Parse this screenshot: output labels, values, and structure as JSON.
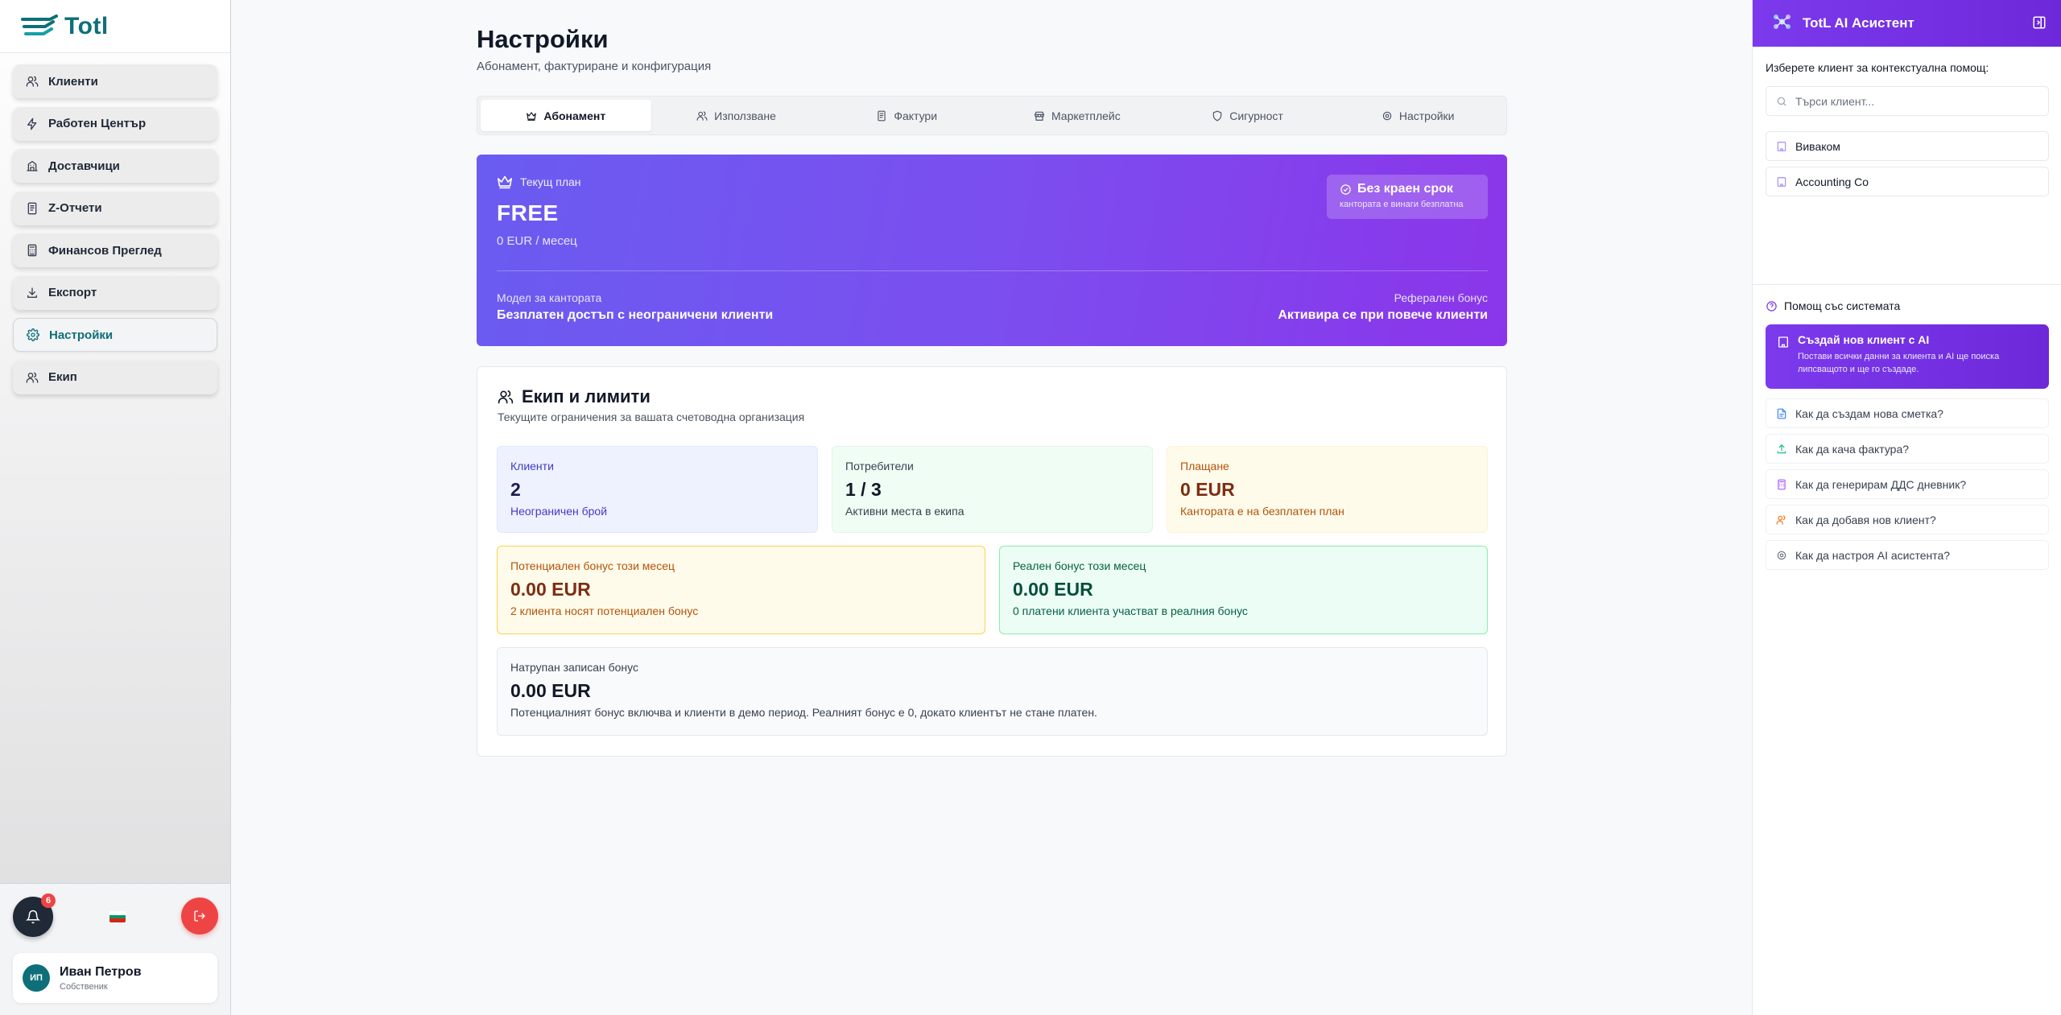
{
  "brand": {
    "name": "Totl"
  },
  "sidebar": {
    "items": [
      {
        "label": "Клиенти",
        "icon": "users-icon",
        "active": false
      },
      {
        "label": "Работен Център",
        "icon": "bolt-icon",
        "active": false
      },
      {
        "label": "Доставчици",
        "icon": "building-icon",
        "active": false
      },
      {
        "label": "Z-Отчети",
        "icon": "receipt-icon",
        "active": false
      },
      {
        "label": "Финансов Преглед",
        "icon": "calculator-icon",
        "active": false
      },
      {
        "label": "Експорт",
        "icon": "download-icon",
        "active": false
      },
      {
        "label": "Настройки",
        "icon": "gear-icon",
        "active": true
      },
      {
        "label": "Екип",
        "icon": "team-icon",
        "active": false
      }
    ],
    "notifications_count": "6",
    "user": {
      "initials": "ИП",
      "name": "Иван Петров",
      "role": "Собственик"
    }
  },
  "page": {
    "title": "Настройки",
    "subtitle": "Абонамент, фактуриране и конфигурация"
  },
  "tabs": [
    {
      "label": "Абонамент",
      "icon": "crown-icon",
      "active": true
    },
    {
      "label": "Използване",
      "icon": "users-icon",
      "active": false
    },
    {
      "label": "Фактури",
      "icon": "document-icon",
      "active": false
    },
    {
      "label": "Маркетплейс",
      "icon": "store-icon",
      "active": false
    },
    {
      "label": "Сигурност",
      "icon": "shield-icon",
      "active": false
    },
    {
      "label": "Настройки",
      "icon": "gear-icon",
      "active": false
    }
  ],
  "plan": {
    "label": "Текущ план",
    "name": "FREE",
    "price": "0 EUR / месец",
    "badge_title": "Без краен срок",
    "badge_sub": "кантората е винаги безплатна",
    "model_label": "Модел за кантората",
    "model_value": "Безплатен достъп с неограничени клиенти",
    "referral_label": "Реферален бонус",
    "referral_value": "Активира се при повече клиенти"
  },
  "team": {
    "title": "Екип и лимити",
    "subtitle": "Текущите ограничения за вашата счетоводна организация",
    "stats": [
      {
        "label": "Клиенти",
        "value": "2",
        "note": "Неограничен брой"
      },
      {
        "label": "Потребители",
        "value": "1 / 3",
        "note": "Активни места в екипа"
      },
      {
        "label": "Плащане",
        "value": "0 EUR",
        "note": "Кантората е на безплатен план"
      }
    ],
    "bonuses": [
      {
        "label": "Потенциален бонус този месец",
        "value": "0.00 EUR",
        "note": "2 клиента носят потенциален бонус"
      },
      {
        "label": "Реален бонус този месец",
        "value": "0.00 EUR",
        "note": "0 платени клиента участват в реалния бонус"
      }
    ],
    "accumulated": {
      "label": "Натрупан записан бонус",
      "value": "0.00 EUR",
      "note": "Потенциалният бонус включва и клиенти в демо период. Реалният бонус е 0, докато клиентът не стане платен."
    }
  },
  "ai": {
    "title": "TotL AI Асистент",
    "prompt": "Изберете клиент за контекстуална помощ:",
    "search_placeholder": "Търси клиент...",
    "clients": [
      "Виваком",
      "Accounting Co"
    ],
    "help_title": "Помощ със системата",
    "create": {
      "title": "Създай нов клиент с AI",
      "desc": "Постави всички данни за клиента и AI ще поиска липсващото и ще го създаде."
    },
    "help_items": [
      {
        "label": "Как да създам нова сметка?",
        "icon": "document-icon",
        "color": "#3b82f6"
      },
      {
        "label": "Как да кача фактура?",
        "icon": "upload-icon",
        "color": "#10b981"
      },
      {
        "label": "Как да генерирам ДДС дневник?",
        "icon": "calculator-icon",
        "color": "#a855f7"
      },
      {
        "label": "Как да добавя нов клиент?",
        "icon": "users-icon",
        "color": "#f97316"
      },
      {
        "label": "Как да настроя AI асистента?",
        "icon": "gear-icon",
        "color": "#6b7280"
      }
    ]
  },
  "colors": {
    "brand": "#0e6f78",
    "accent_purple": "#7c3aed",
    "danger": "#ef4444"
  }
}
